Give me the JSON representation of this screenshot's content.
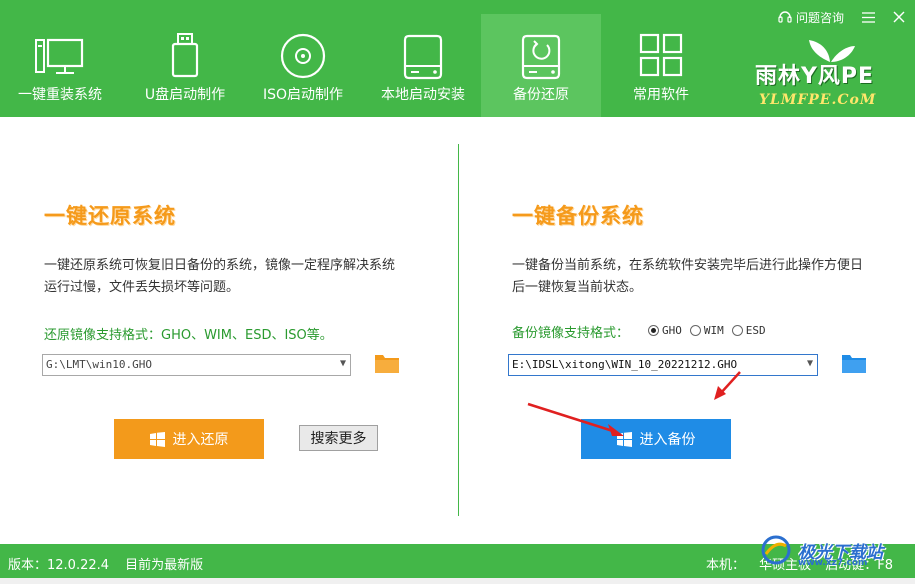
{
  "header": {
    "nav": [
      {
        "label": "一键重装系统",
        "icon": "computer-icon"
      },
      {
        "label": "U盘启动制作",
        "icon": "usb-drive-icon"
      },
      {
        "label": "ISO启动制作",
        "icon": "disc-icon"
      },
      {
        "label": "本地启动安装",
        "icon": "hard-drive-icon"
      },
      {
        "label": "备份还原",
        "icon": "backup-drive-icon",
        "active": true
      },
      {
        "label": "常用软件",
        "icon": "apps-grid-icon"
      }
    ],
    "help_label": "问题咨询",
    "menu_icon": "menu-icon",
    "close_icon": "close-icon",
    "logo_main": "雨林Y风PE",
    "logo_sub": "YLMFPE.CoM"
  },
  "restore": {
    "title": "一键还原系统",
    "desc": "一键还原系统可恢复旧日备份的系统，镜像一定程序解决系统运行过慢，文件丢失损坏等问题。",
    "formats": "还原镜像支持格式：GHO、WIM、ESD、ISO等。",
    "path_value": "G:\\LMT\\win10.GHO",
    "button_label": "进入还原",
    "search_label": "搜索更多"
  },
  "backup": {
    "title": "一键备份系统",
    "desc": "一键备份当前系统，在系统软件安装完毕后进行此操作方便日后一键恢复当前状态。",
    "formats_label": "备份镜像支持格式：",
    "options": [
      {
        "label": "GHO",
        "checked": true
      },
      {
        "label": "WIM",
        "checked": false
      },
      {
        "label": "ESD",
        "checked": false
      }
    ],
    "path_value": "E:\\IDSL\\xitong\\WIN_10_20221212.GHO",
    "button_label": "进入备份"
  },
  "footer": {
    "version": "版本：12.0.22.4",
    "status": "目前为最新版",
    "machine": "本机：",
    "board": "华硕主板",
    "boot_key": "启动键：F8"
  },
  "watermark": {
    "text": "极光下载站",
    "url": "www.xz7.com"
  },
  "colors": {
    "brand_green": "#43b748",
    "orange": "#f39a1b",
    "blue": "#1f8ce6"
  }
}
